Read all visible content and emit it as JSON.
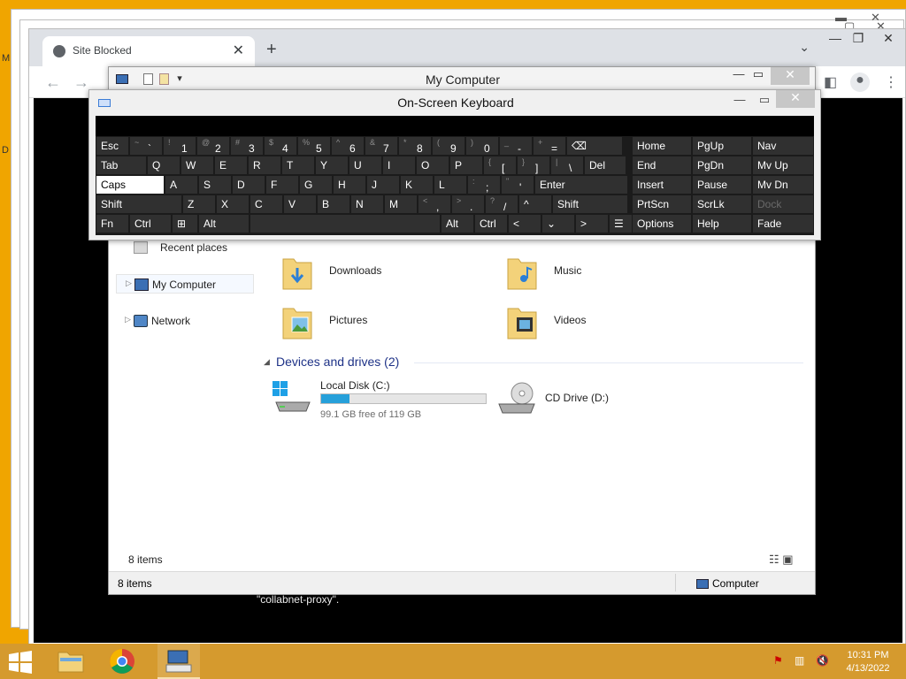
{
  "background": {
    "left_edge_letters": [
      "M",
      "D"
    ]
  },
  "browser": {
    "tab_title": "Site Blocked",
    "tab_close": "✕",
    "new_tab": "+",
    "page_text": "\"collabnet-proxy\"."
  },
  "explorer": {
    "title": "My Computer",
    "sidebar": [
      {
        "label": "Recent places"
      },
      {
        "label": "My Computer"
      },
      {
        "label": "Network"
      }
    ],
    "folders": [
      {
        "label": "Downloads"
      },
      {
        "label": "Music"
      },
      {
        "label": "Pictures"
      },
      {
        "label": "Videos"
      }
    ],
    "group_header": "Devices and drives (2)",
    "drives": [
      {
        "label": "Local Disk (C:)",
        "free_text": "99.1 GB free of 119 GB",
        "used_fraction": 0.17
      },
      {
        "label": "CD Drive (D:)"
      }
    ],
    "items_count": "8 items",
    "status_left": "8 items",
    "status_right": "Computer"
  },
  "osk": {
    "title": "On-Screen Keyboard",
    "rows": [
      [
        {
          "main": "Esc"
        },
        {
          "shift": "~",
          "main": "`"
        },
        {
          "shift": "!",
          "main": "1"
        },
        {
          "shift": "@",
          "main": "2"
        },
        {
          "shift": "#",
          "main": "3"
        },
        {
          "shift": "$",
          "main": "4"
        },
        {
          "shift": "%",
          "main": "5"
        },
        {
          "shift": "^",
          "main": "6"
        },
        {
          "shift": "&",
          "main": "7"
        },
        {
          "shift": "*",
          "main": "8"
        },
        {
          "shift": "(",
          "main": "9"
        },
        {
          "shift": ")",
          "main": "0"
        },
        {
          "shift": "_",
          "main": "-"
        },
        {
          "shift": "+",
          "main": "="
        },
        {
          "main": "⌫"
        }
      ],
      [
        {
          "main": "Tab"
        },
        {
          "main": "Q"
        },
        {
          "main": "W"
        },
        {
          "main": "E"
        },
        {
          "main": "R"
        },
        {
          "main": "T"
        },
        {
          "main": "Y"
        },
        {
          "main": "U"
        },
        {
          "main": "I"
        },
        {
          "main": "O"
        },
        {
          "main": "P"
        },
        {
          "shift": "{",
          "main": "["
        },
        {
          "shift": "}",
          "main": "]"
        },
        {
          "shift": "|",
          "main": "\\"
        },
        {
          "main": "Del"
        }
      ],
      [
        {
          "main": "Caps"
        },
        {
          "main": "A"
        },
        {
          "main": "S"
        },
        {
          "main": "D"
        },
        {
          "main": "F"
        },
        {
          "main": "G"
        },
        {
          "main": "H"
        },
        {
          "main": "J"
        },
        {
          "main": "K"
        },
        {
          "main": "L"
        },
        {
          "shift": ":",
          "main": ";"
        },
        {
          "shift": "\"",
          "main": "'"
        },
        {
          "main": "Enter"
        }
      ],
      [
        {
          "main": "Shift"
        },
        {
          "main": "Z"
        },
        {
          "main": "X"
        },
        {
          "main": "C"
        },
        {
          "main": "V"
        },
        {
          "main": "B"
        },
        {
          "main": "N"
        },
        {
          "main": "M"
        },
        {
          "shift": "<",
          "main": ","
        },
        {
          "shift": ">",
          "main": "."
        },
        {
          "shift": "?",
          "main": "/"
        },
        {
          "main": "^"
        },
        {
          "main": "Shift"
        }
      ],
      [
        {
          "main": "Fn"
        },
        {
          "main": "Ctrl"
        },
        {
          "main": "⊞"
        },
        {
          "main": "Alt"
        },
        {
          "main": ""
        },
        {
          "main": "Alt"
        },
        {
          "main": "Ctrl"
        },
        {
          "main": "<"
        },
        {
          "main": "⌄"
        },
        {
          "main": ">"
        },
        {
          "main": "☰"
        }
      ]
    ],
    "nav": [
      [
        "Home",
        "PgUp",
        "Nav"
      ],
      [
        "End",
        "PgDn",
        "Mv Up"
      ],
      [
        "Insert",
        "Pause",
        "Mv Dn"
      ],
      [
        "PrtScn",
        "ScrLk",
        "Dock"
      ],
      [
        "Options",
        "Help",
        "Fade"
      ]
    ]
  },
  "taskbar": {
    "time": "10:31 PM",
    "date": "4/13/2022"
  }
}
